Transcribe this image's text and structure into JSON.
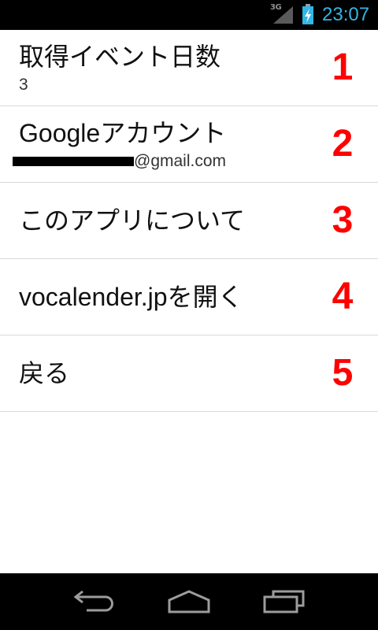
{
  "status_bar": {
    "network": "3G",
    "time": "23:07",
    "signal_icon": "signal-icon",
    "battery_icon": "battery-charging-icon"
  },
  "settings": {
    "items": [
      {
        "title": "取得イベント日数",
        "summary": "3",
        "marker": "1"
      },
      {
        "title": "Googleアカウント",
        "summary": "@gmail.com",
        "marker": "2"
      },
      {
        "title": "このアプリについて",
        "marker": "3"
      },
      {
        "title": "vocalender.jpを開く",
        "marker": "4"
      },
      {
        "title": "戻る",
        "marker": "5"
      }
    ]
  },
  "nav_bar": {
    "buttons": [
      {
        "icon": "back-icon"
      },
      {
        "icon": "home-icon"
      },
      {
        "icon": "recent-apps-icon"
      }
    ]
  },
  "colors": {
    "accent": "#33b5e5",
    "marker": "#ff0000",
    "divider": "#d9d9d9",
    "background": "#ffffff",
    "bars": "#000000",
    "nav_icon": "#9c9c9c"
  }
}
